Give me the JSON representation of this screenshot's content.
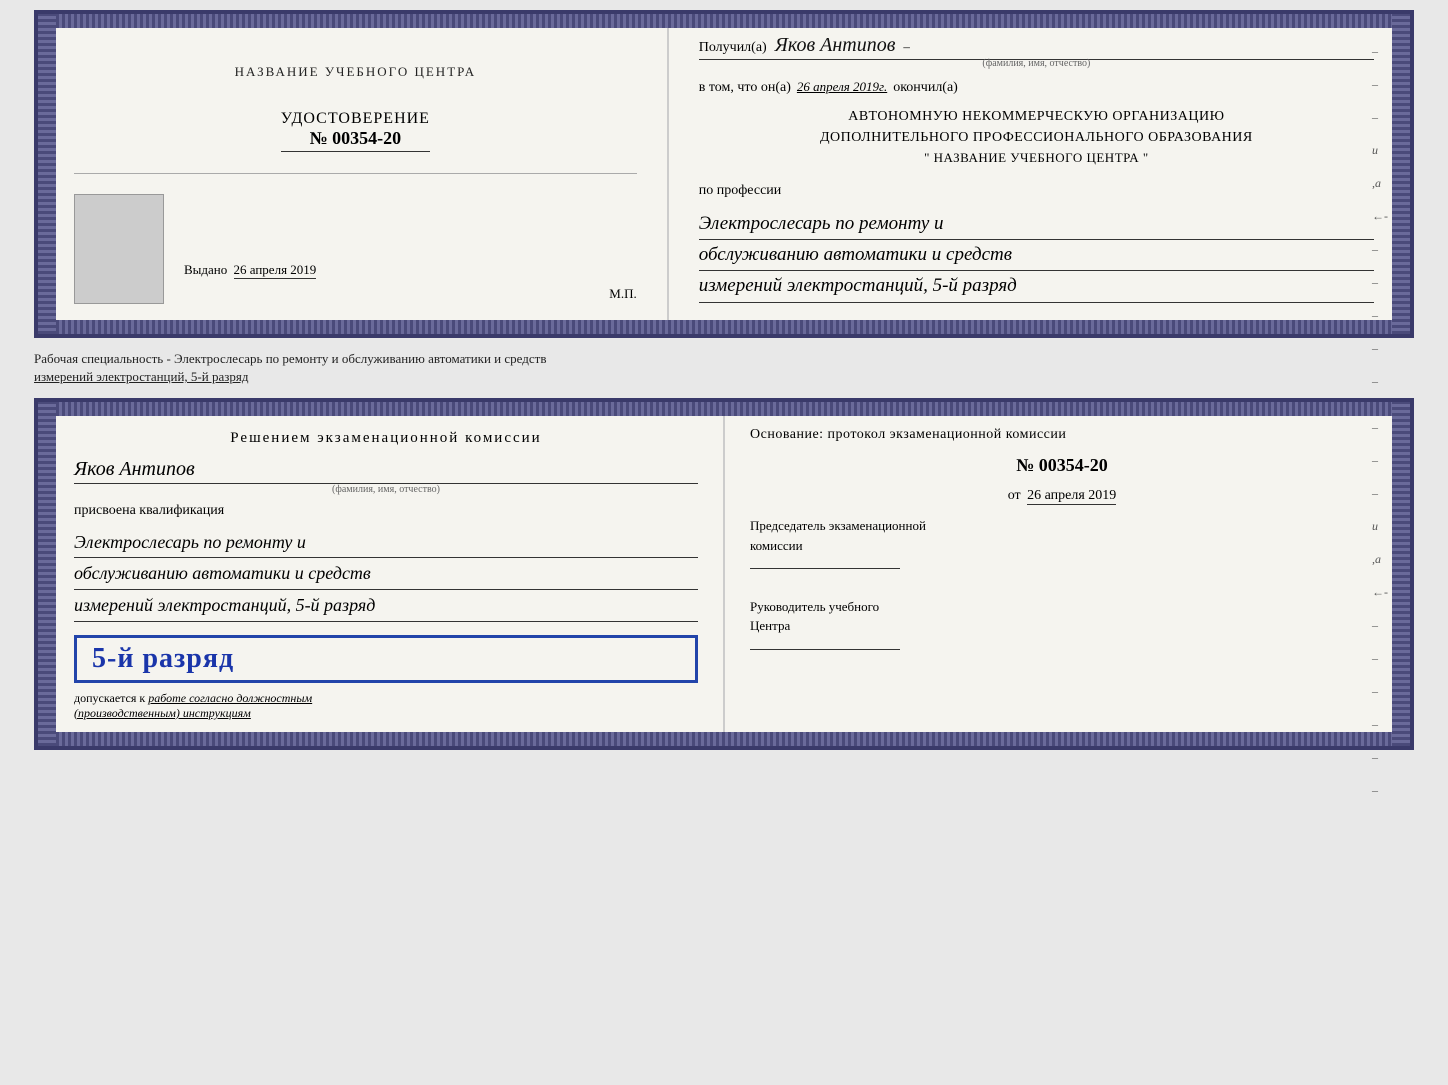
{
  "top_book": {
    "left_page": {
      "org_title": "НАЗВАНИЕ УЧЕБНОГО ЦЕНТРА",
      "cert_label": "УДОСТОВЕРЕНИЕ",
      "cert_number": "№ 00354-20",
      "vydano_prefix": "Выдано",
      "vydano_date": "26 апреля 2019",
      "mp_label": "М.П."
    },
    "right_page": {
      "poluchil_prefix": "Получил(а)",
      "recipient_name": "Яков Антипов",
      "fio_hint": "(фамилия, имя, отчество)",
      "vtom_prefix": "в том, что он(а)",
      "date_value": "26 апреля 2019г.",
      "okonchil": "окончил(а)",
      "org_line1": "АВТОНОМНУЮ НЕКОММЕРЧЕСКУЮ ОРГАНИЗАЦИЮ",
      "org_line2": "ДОПОЛНИТЕЛЬНОГО ПРОФЕССИОНАЛЬНОГО ОБРАЗОВАНИЯ",
      "org_name": "\"  НАЗВАНИЕ УЧЕБНОГО ЦЕНТРА  \"",
      "po_professii": "по профессии",
      "profession_line1": "Электрослесарь по ремонту и",
      "profession_line2": "обслуживанию автоматики и средств",
      "profession_line3": "измерений электростанций, 5-й разряд"
    }
  },
  "separator": {
    "text1": "Рабочая специальность - Электрослесарь по ремонту и обслуживанию автоматики и средств",
    "text2": "измерений электростанций, 5-й разряд"
  },
  "bottom_book": {
    "left_page": {
      "decision_title": "Решением  экзаменационной  комиссии",
      "name": "Яков Антипов",
      "fio_hint": "(фамилия, имя, отчество)",
      "prisvoena": "присвоена квалификация",
      "qual_line1": "Электрослесарь по ремонту и",
      "qual_line2": "обслуживанию автоматики и средств",
      "qual_line3": "измерений электростанций, 5-й разряд",
      "rank_text": "5-й разряд",
      "dopuskaetsya_prefix": "допускается к",
      "dopuskaetsya_value": "работе согласно должностным",
      "dopuskaetsya_line2": "(производственным) инструкциям"
    },
    "right_page": {
      "osnovanie": "Основание: протокол экзаменационной  комиссии",
      "protocol_number": "№  00354-20",
      "ot_prefix": "от",
      "ot_date": "26 апреля 2019",
      "chairman_label": "Председатель экзаменационной",
      "chairman_label2": "комиссии",
      "rukovoditel_label": "Руководитель учебного",
      "rukovoditel_label2": "Центра"
    }
  }
}
